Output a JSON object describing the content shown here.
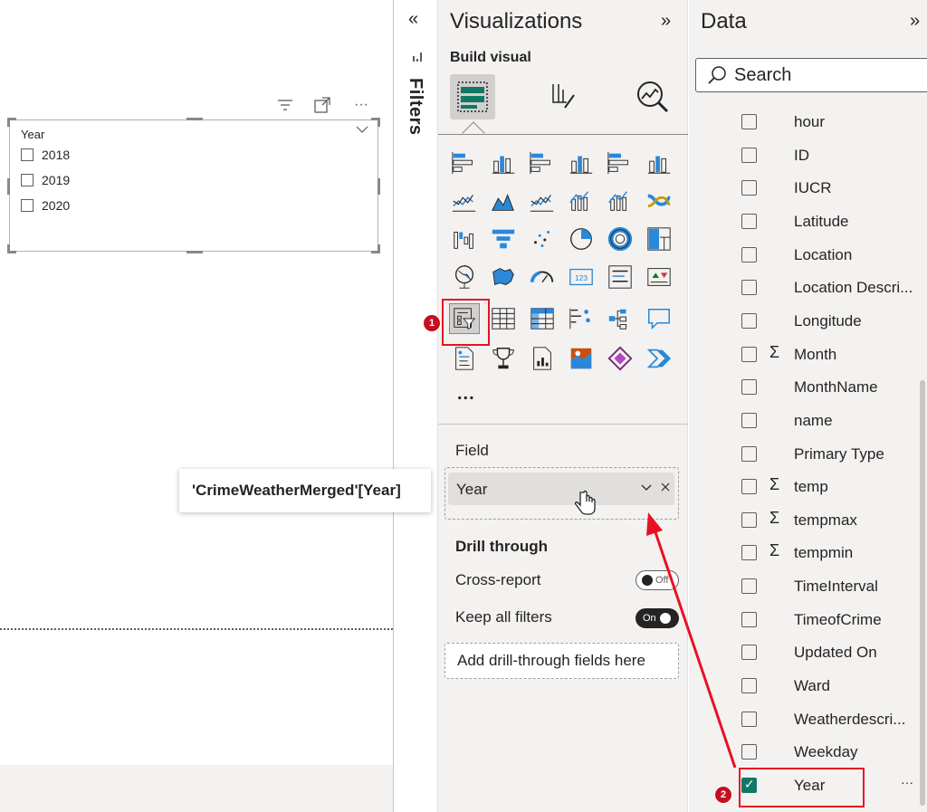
{
  "canvas": {
    "slicer": {
      "title": "Year",
      "items": [
        {
          "label": "2018",
          "checked": false
        },
        {
          "label": "2019",
          "checked": false
        },
        {
          "label": "2020",
          "checked": false
        }
      ]
    },
    "header_icons": [
      "filter-icon",
      "focus-mode-icon",
      "more-options-icon"
    ],
    "more_glyph": "···"
  },
  "filters": {
    "label": "Filters",
    "collapse_glyph": "«"
  },
  "visualizations": {
    "title": "Visualizations",
    "expand_glyph": "»",
    "build_visual_label": "Build visual",
    "more_glyph": "...",
    "field_label": "Field",
    "field_value": "Year",
    "drill_through": {
      "heading": "Drill through",
      "cross_report_label": "Cross-report",
      "cross_report_state": "Off",
      "keep_filters_label": "Keep all filters",
      "keep_filters_state": "On",
      "add_placeholder": "Add drill-through fields here"
    },
    "tooltip": "'CrimeWeatherMerged'[Year]",
    "icon_names": [
      "stacked-bar-chart-icon",
      "stacked-column-chart-icon",
      "clustered-bar-chart-icon",
      "clustered-column-chart-icon",
      "100-stacked-bar-chart-icon",
      "100-stacked-column-chart-icon",
      "line-chart-icon",
      "area-chart-icon",
      "stacked-area-chart-icon",
      "line-and-stacked-column-chart-icon",
      "line-and-clustered-column-chart-icon",
      "ribbon-chart-icon",
      "waterfall-chart-icon",
      "funnel-chart-icon",
      "scatter-chart-icon",
      "pie-chart-icon",
      "donut-chart-icon",
      "treemap-icon",
      "map-icon",
      "filled-map-icon",
      "gauge-icon",
      "card-icon",
      "multi-row-card-icon",
      "kpi-icon",
      "slicer-icon",
      "table-icon",
      "matrix-icon",
      "key-influencers-icon",
      "decomposition-tree-icon",
      "qa-icon",
      "smart-narrative-icon",
      "metrics-icon",
      "paginated-report-icon",
      "azure-map-icon",
      "power-apps-icon",
      "power-automate-icon"
    ]
  },
  "data": {
    "title": "Data",
    "expand_glyph": "»",
    "search_placeholder": "Search",
    "fields": [
      {
        "name": "hour",
        "sigma": false,
        "checked": false
      },
      {
        "name": "ID",
        "sigma": false,
        "checked": false
      },
      {
        "name": "IUCR",
        "sigma": false,
        "checked": false
      },
      {
        "name": "Latitude",
        "sigma": false,
        "checked": false
      },
      {
        "name": "Location",
        "sigma": false,
        "checked": false
      },
      {
        "name": "Location Descri...",
        "sigma": false,
        "checked": false
      },
      {
        "name": "Longitude",
        "sigma": false,
        "checked": false
      },
      {
        "name": "Month",
        "sigma": true,
        "checked": false
      },
      {
        "name": "MonthName",
        "sigma": false,
        "checked": false
      },
      {
        "name": "name",
        "sigma": false,
        "checked": false
      },
      {
        "name": "Primary Type",
        "sigma": false,
        "checked": false
      },
      {
        "name": "temp",
        "sigma": true,
        "checked": false
      },
      {
        "name": "tempmax",
        "sigma": true,
        "checked": false
      },
      {
        "name": "tempmin",
        "sigma": true,
        "checked": false
      },
      {
        "name": "TimeInterval",
        "sigma": false,
        "checked": false
      },
      {
        "name": "TimeofCrime",
        "sigma": false,
        "checked": false
      },
      {
        "name": "Updated On",
        "sigma": false,
        "checked": false
      },
      {
        "name": "Ward",
        "sigma": false,
        "checked": false
      },
      {
        "name": "Weatherdescri...",
        "sigma": false,
        "checked": false
      },
      {
        "name": "Weekday",
        "sigma": false,
        "checked": false
      },
      {
        "name": "Year",
        "sigma": false,
        "checked": true
      }
    ],
    "sigma_glyph": "Σ",
    "row_more_glyph": "···"
  },
  "annotations": {
    "badge_1": "1",
    "badge_2": "2",
    "highlight_color": "#e81123",
    "arrow_color": "#e81123"
  },
  "colors": {
    "accent_blue": "#2b88d8",
    "dark_teal": "#117865",
    "pane_bg": "#f3f2f1"
  }
}
